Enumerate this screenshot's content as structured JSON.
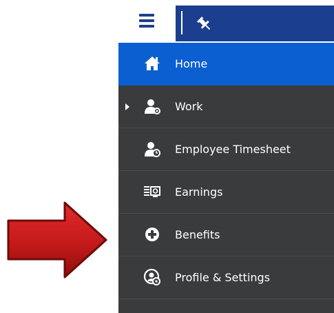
{
  "menu": {
    "items": [
      {
        "label": "Home",
        "icon": "home-icon",
        "active": true
      },
      {
        "label": "Work",
        "icon": "work-icon",
        "expandable": true
      },
      {
        "label": "Employee Timesheet",
        "icon": "employee-timesheet-icon"
      },
      {
        "label": "Earnings",
        "icon": "earnings-icon"
      },
      {
        "label": "Benefits",
        "icon": "plus-circle-icon"
      },
      {
        "label": "Profile & Settings",
        "icon": "profile-settings-icon"
      }
    ]
  },
  "header": {
    "menu_icon": "hamburger-icon",
    "pin_icon": "pin-icon"
  },
  "colors": {
    "header_blue": "#1b3f8e",
    "active_blue": "#0b5fd1",
    "menu_bg": "#3a3b3d",
    "arrow_red": "#c81e1e"
  },
  "annotation": {
    "type": "arrow",
    "points_to": "Benefits"
  }
}
